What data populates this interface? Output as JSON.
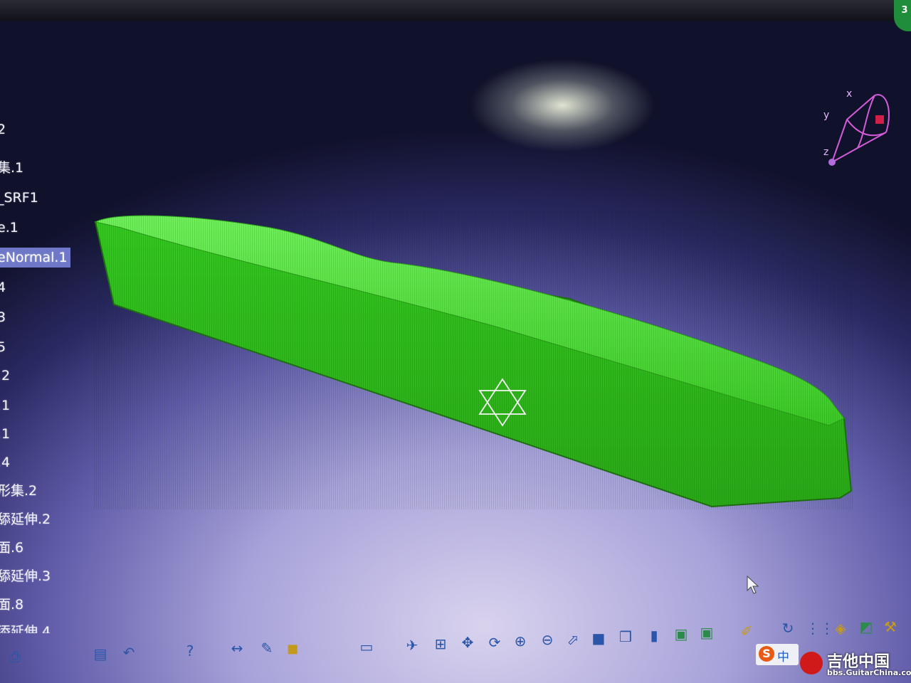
{
  "status_badge": "3",
  "spec_tree": {
    "items": [
      {
        "label": "2",
        "selected": false
      },
      {
        "label": "集.1",
        "selected": false
      },
      {
        "label": "_SRF1",
        "selected": false
      },
      {
        "label": "e.1",
        "selected": false
      },
      {
        "label": "eNormal.1",
        "selected": true
      },
      {
        "label": "4",
        "selected": false
      },
      {
        "label": "3",
        "selected": false
      },
      {
        "label": "5",
        "selected": false
      },
      {
        "label": ".2",
        "selected": false
      },
      {
        "label": ".1",
        "selected": false
      },
      {
        "label": ".1",
        "selected": false
      },
      {
        "label": ".4",
        "selected": false
      },
      {
        "label": "形集.2",
        "selected": false
      },
      {
        "label": "舔延伸.2",
        "selected": false
      },
      {
        "label": "面.6",
        "selected": false
      },
      {
        "label": "舔延伸.3",
        "selected": false
      },
      {
        "label": "面.8",
        "selected": false
      },
      {
        "label": "添延伸.4",
        "selected": false
      }
    ]
  },
  "compass": {
    "x_label": "x",
    "y_label": "y",
    "z_label": "z"
  },
  "colors": {
    "model_green": "#3fd22a",
    "tree_selection": "#6f78c8",
    "compass_magenta": "#d45bd8"
  },
  "toolbar": {
    "icons": [
      "print-icon",
      "paste-icon",
      "undo-icon",
      "help-icon",
      "measure-icon",
      "sketch-icon",
      "material-icon",
      "window-icon",
      "fly-icon",
      "fit-all-icon",
      "pan-icon",
      "rotate-icon",
      "zoom-in-icon",
      "zoom-out-icon",
      "normal-view-icon",
      "shading-icon",
      "cube-view-icon",
      "hide-show-icon",
      "swap-icon",
      "render-icon",
      "brush-icon",
      "update-icon",
      "grid-icon",
      "analysis-icon",
      "surface-icon",
      "tools-icon"
    ]
  },
  "ime": {
    "logo": "S",
    "mode": "中"
  },
  "watermark": {
    "title": "吉他中国",
    "url": "bbs.GuitarChina.com"
  }
}
